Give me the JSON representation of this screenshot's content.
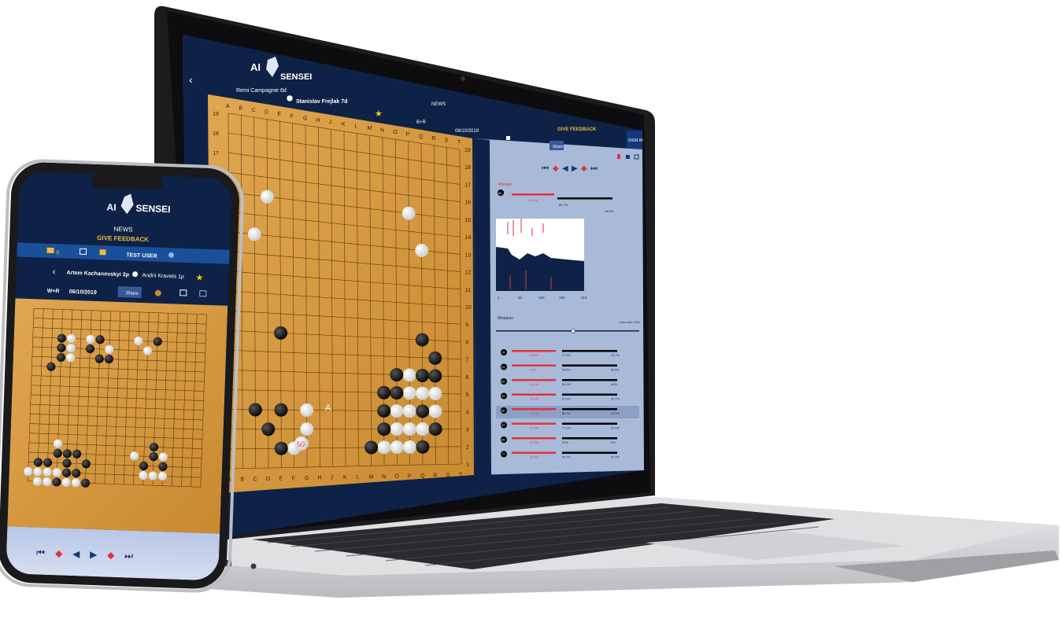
{
  "brand": {
    "ai": "AI",
    "sensei": "SENSEI"
  },
  "laptop": {
    "players": {
      "black": "Remi Campagnie 6d",
      "white": "Stanislav Frejlak 7d"
    },
    "nav": {
      "news": "NEWS",
      "give_feedback": "GIVE FEEDBACK",
      "sign_in": "SIGN IN"
    },
    "result": "B+R",
    "date": "06/10/2019",
    "public_label": "Public?",
    "share_label": "Share",
    "win_rate": {
      "label": "Winrate",
      "move": "50",
      "loss": "-19.1%",
      "mid": "80.7%",
      "right": "18.3%"
    },
    "graph_axis": [
      "1",
      "50",
      "100",
      "150",
      "210"
    ],
    "mistakes_label": "Mistakes",
    "loss_over_label": "Loss over 10%",
    "board_marks": {
      "move_number": "50",
      "label_a": "A"
    },
    "col_labels": [
      "A",
      "B",
      "C",
      "D",
      "E",
      "F",
      "G",
      "H",
      "J",
      "K",
      "L",
      "M",
      "N",
      "O",
      "P",
      "Q",
      "R",
      "S",
      "T"
    ],
    "row_labels": [
      "19",
      "18",
      "17",
      "16",
      "15",
      "14",
      "13",
      "12",
      "11",
      "10",
      "9",
      "8",
      "7",
      "6",
      "5",
      "4",
      "3",
      "2",
      "1"
    ],
    "mistake_rows": [
      {
        "move": "79",
        "loss": "-15.6%",
        "mid": "27.3%",
        "right": "72.7%"
      },
      {
        "move": "23",
        "loss": "-17%",
        "mid": "44.5%",
        "right": "55.5%"
      },
      {
        "move": "83",
        "loss": "-11.2%",
        "mid": "54.1%",
        "right": "46%"
      },
      {
        "move": "33",
        "loss": "-10.9%",
        "mid": "67.3%",
        "right": "32.7%"
      },
      {
        "move": "50",
        "loss": "-19.1%",
        "mid": "80.7%",
        "right": "19.3%"
      },
      {
        "move": "57",
        "loss": "-10.5%",
        "mid": "77.1%",
        "right": "22.9%"
      },
      {
        "move": "85",
        "loss": "-22.2%",
        "mid": "91%",
        "right": "9%"
      },
      {
        "move": "77",
        "loss": "-24.6%",
        "mid": "62.7%",
        "right": "37.3%"
      }
    ]
  },
  "phone": {
    "nav": {
      "news": "NEWS",
      "give_feedback": "GIVE FEEDBACK"
    },
    "coins": "0",
    "user": "TEST USER",
    "players": {
      "black": "Artem Kachanovskyi 2p",
      "white": "Andrii Kravets 1p"
    },
    "result": "W+R",
    "date": "06/10/2019",
    "share_label": "Share"
  },
  "colors": {
    "navy": "#0e2247",
    "header_blue": "#14397a",
    "accent_gold": "#f0b93a",
    "wood": "#d99b3d",
    "panel": "#a9b9d8",
    "red": "#e1323c"
  }
}
